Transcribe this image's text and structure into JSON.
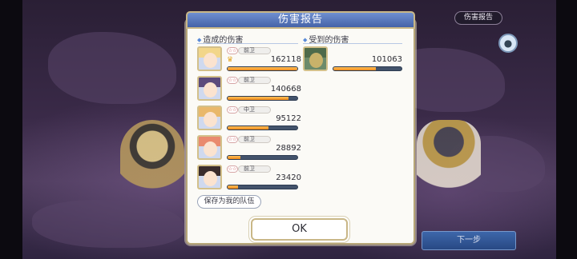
{
  "top_report_button": "伤害报告",
  "next_button": "下一步",
  "dialog": {
    "title": "伤害报告",
    "dealt_section_title": "造成的伤害",
    "received_section_title": "受到的伤害",
    "save_button": "保存为我的队伍",
    "ok_button": "OK"
  },
  "dealt": [
    {
      "position": "前卫",
      "damage": "162118",
      "top_damage": true,
      "bar_fraction": 1.0,
      "stars": "☆☆",
      "hair_color": "#f2d68a"
    },
    {
      "position": "前卫",
      "damage": "140668",
      "top_damage": false,
      "bar_fraction": 0.87,
      "stars": "☆☆",
      "hair_color": "#5b4a7c"
    },
    {
      "position": "中卫",
      "damage": "95122",
      "top_damage": false,
      "bar_fraction": 0.59,
      "stars": "☆☆",
      "hair_color": "#e9b86a"
    },
    {
      "position": "前卫",
      "damage": "28892",
      "top_damage": false,
      "bar_fraction": 0.18,
      "stars": "☆☆",
      "hair_color": "#e98a6e"
    },
    {
      "position": "前卫",
      "damage": "23420",
      "top_damage": false,
      "bar_fraction": 0.15,
      "stars": "☆☆",
      "hair_color": "#3a2c2c"
    }
  ],
  "received": [
    {
      "damage": "101063",
      "bar_fraction": 0.62,
      "hair_color": "#4e6a4a"
    }
  ],
  "colors": {
    "bar_fill": "#f39b2a",
    "bar_track": "#43536b",
    "header": "#5576bc",
    "frame": "#c9b787"
  }
}
